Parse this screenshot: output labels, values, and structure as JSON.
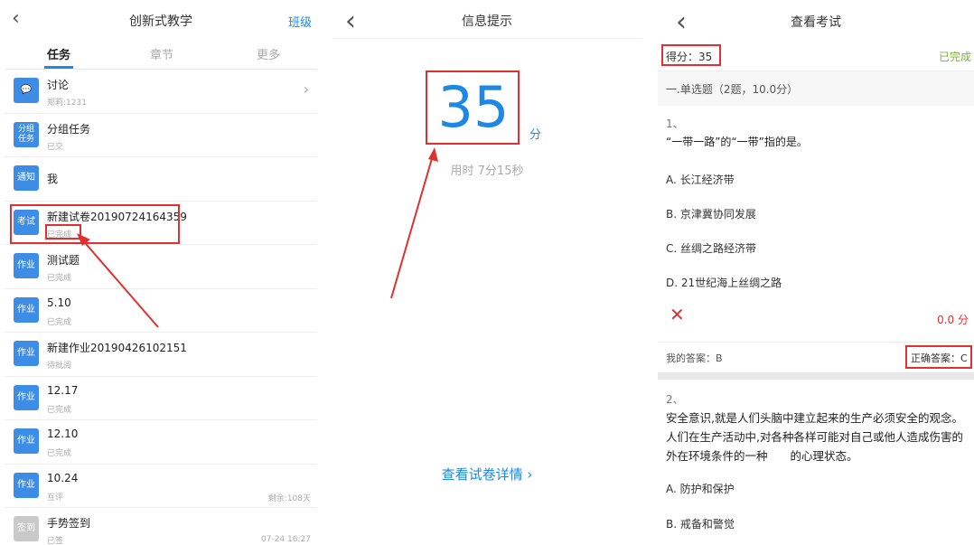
{
  "panel1": {
    "header": {
      "back_icon": "chevron-left-icon",
      "title": "创新式教学",
      "right_link": "班级"
    },
    "tabs": [
      "任务",
      "章节",
      "更多"
    ],
    "active_tab": 0,
    "items": [
      {
        "badge": "💬",
        "badge_icon": "chat-icon",
        "title": "讨论",
        "sub": "郑莉:1231",
        "right": "",
        "chevron": true
      },
      {
        "badge": "分组\n任务",
        "title": "分组任务",
        "sub": "已交",
        "right": ""
      },
      {
        "badge": "通知",
        "title": "我",
        "sub": "",
        "right": ""
      },
      {
        "badge": "考试",
        "title": "新建试卷20190724164359",
        "sub": "已完成",
        "right": ""
      },
      {
        "badge": "作业",
        "title": "测试题",
        "sub": "已完成",
        "right": ""
      },
      {
        "badge": "作业",
        "title": "5.10",
        "sub": "已完成",
        "right": ""
      },
      {
        "badge": "作业",
        "title": "新建作业20190426102151",
        "sub": "待批阅",
        "right": ""
      },
      {
        "badge": "作业",
        "title": "12.17",
        "sub": "已完成",
        "right": ""
      },
      {
        "badge": "作业",
        "title": "12.10",
        "sub": "已完成",
        "right": ""
      },
      {
        "badge": "作业",
        "title": "10.24",
        "sub": "互评",
        "right": "剩余:108天"
      },
      {
        "badge": "签到",
        "title": "手势签到",
        "sub": "已签",
        "right": "07-24 16:27",
        "gray": true
      }
    ],
    "colors": {
      "accent": "#1e88e5",
      "highlight": "#e0302f"
    }
  },
  "panel2": {
    "title": "信息提示",
    "score": "35",
    "unit": "分",
    "time": "用时 7分15秒",
    "detail_link": "查看试卷详情 ›"
  },
  "panel3": {
    "title": "查看考试",
    "score_label": "得分：35",
    "status": "已完成",
    "section": "一.单选题（2题，10.0分）",
    "q1": {
      "num": "1、",
      "text": "“一带一路”的“一带”指的是。",
      "options": [
        "A. 长江经济带",
        "B. 京津冀协同发展",
        "C. 丝绸之路经济带",
        "D. 21世纪海上丝绸之路"
      ],
      "result_icon": "wrong-x-icon",
      "points": "0.0 分",
      "my_answer": "我的答案：B",
      "correct_answer": "正确答案：C"
    },
    "q2": {
      "num": "2、",
      "text": "安全意识,就是人们头脑中建立起来的生产必须安全的观念。人们在生产活动中,对各种各样可能对自己或他人造成伤害的外在环境条件的一种　　的心理状态。",
      "options": [
        "A. 防护和保护",
        "B. 戒备和警觉"
      ]
    }
  }
}
